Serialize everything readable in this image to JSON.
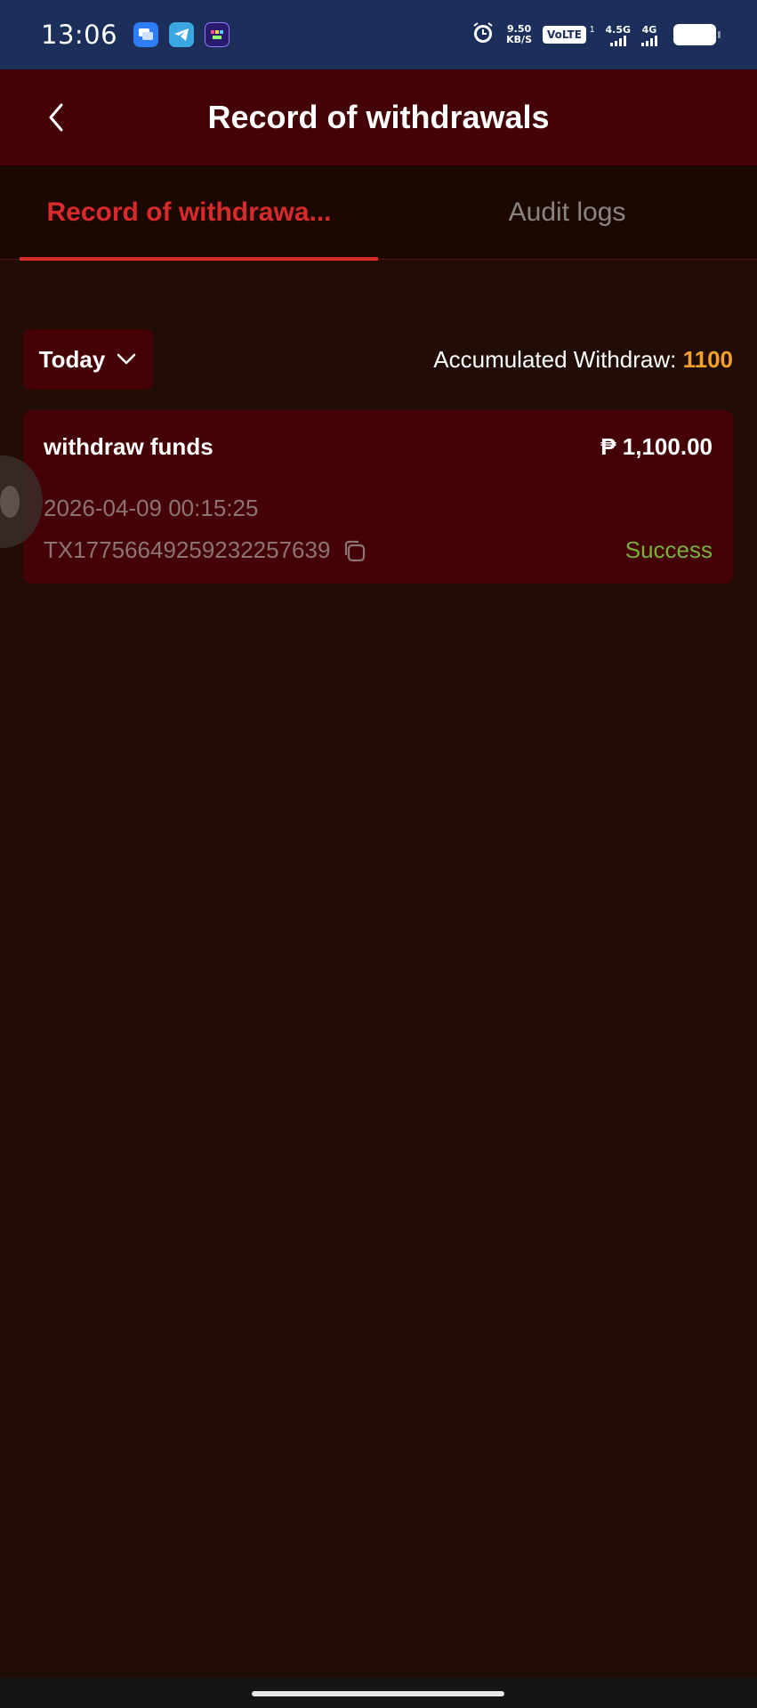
{
  "status_bar": {
    "time": "13:06",
    "speed_value": "9.50",
    "speed_unit": "KB/S",
    "volte": "VoLTE",
    "volte_sim": "1",
    "net1": "4.5G",
    "net2": "4G",
    "apps": [
      "messages-icon",
      "telegram-icon",
      "game-app-icon"
    ]
  },
  "header": {
    "title": "Record of withdrawals"
  },
  "tabs": [
    {
      "label": "Record of withdrawa...",
      "active": true
    },
    {
      "label": "Audit logs",
      "active": false
    }
  ],
  "filter": {
    "date_range": "Today",
    "accumulated_label": "Accumulated Withdraw: ",
    "accumulated_value": "1100"
  },
  "records": [
    {
      "title": "withdraw funds",
      "amount": "₱ 1,100.00",
      "datetime": "2026-04-09 00:15:25",
      "tx_id": "TX17756649259232257639",
      "status": "Success"
    }
  ],
  "colors": {
    "header_bg": "#450206",
    "page_bg": "#210d05",
    "accent_red": "#d82a2a",
    "accum_value": "#f2a12c",
    "status_success": "#7ab13a"
  }
}
